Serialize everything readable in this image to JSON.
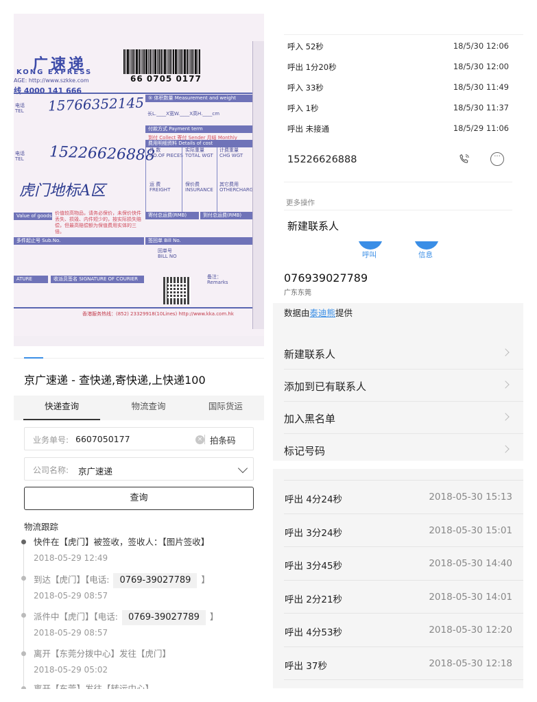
{
  "waybill": {
    "brand_cn": "广速递",
    "brand_en": "KONG EXPRESS",
    "website": "AGE: http://www.szkke.com",
    "hotline": "线 4000 141 666",
    "tracking_number": "66 0705 0177",
    "sender_phone": "15766352145",
    "receiver_phone": "15226626888",
    "receiver_address": "虎门地标A区",
    "label_tel": "电话\nTEL",
    "label_tel2": "电话\nTEL",
    "label_sub_no": "多件起止号 Sub.No.",
    "label_volume": "⑤ 体积数量 Measurement and weight",
    "label_payment": "付款方式 Payment term",
    "label_pay_options": "到付 Collect   寄付 Sender   月结 Monthly",
    "label_fee": "费用明细资料 Details of cost",
    "label_pieces": "件 数\nNO.OF PIECES",
    "label_total_wgt": "实际重量\nTOTAL WGT",
    "label_chg_wgt": "计费重量\nCHG WGT",
    "label_freight": "运 费\nFREIGHT",
    "label_insurance": "保价费\nINSURANCE",
    "label_other": "其它费用\nOTHERCHARGES",
    "label_prepaid": "寄付总运费(RMB)",
    "label_collect": "到付总运费(RMB)",
    "label_bill": "签回单 Bill No.",
    "label_bill_opt": "回单号\nBILL NO",
    "label_signature": "ATURE",
    "label_courier_sign": "收派员签名 SIGNATURE OF COURIER",
    "label_remarks": "备注：\nRemarks",
    "label_value": "Value of goods",
    "label_hk_hotline": "香港服务热线：(852) 23329918(10Lines)  http://www.kka.com.hk",
    "label_notice": "价值较高物品，请务必保价，未保价快件丢失、损毁、内件短少的，按实际损失赔偿，但最高赔偿额为保值费用实体的三倍。"
  },
  "query": {
    "title": "京广速递 - 查快递,寄快递,上快递100",
    "tabs": [
      "快递查询",
      "物流查询",
      "国际货运"
    ],
    "tracking_label": "业务单号:",
    "tracking_value": "6607050177",
    "scan_label": "拍条码",
    "company_label": "公司名称:",
    "company_value": "京广速递",
    "query_button": "查询",
    "tracking_title": "物流跟踪",
    "events": [
      {
        "text": "快件在【虎门】被签收，签收人：【图片签收】",
        "time": "2018-05-29 12:49"
      },
      {
        "prefix": "到达【虎门】【电话:",
        "phone": "0769-39027789",
        "suffix": "】",
        "time": "2018-05-29 08:57"
      },
      {
        "prefix": "派件中【虎门】【电话:",
        "phone": "0769-39027789",
        "suffix": "】",
        "time": "2018-05-29 08:57"
      },
      {
        "text": "离开【东莞分拨中心】发往【虎门】",
        "time": "2018-05-29 05:02"
      },
      {
        "text": "离开【东莞】发往【转运中心】",
        "time": ""
      }
    ]
  },
  "call_top": {
    "rows": [
      {
        "label": "呼入 52秒",
        "time": "18/5/30 12:06"
      },
      {
        "label": "呼出 1分20秒",
        "time": "18/5/30 12:00"
      },
      {
        "label": "呼入 33秒",
        "time": "18/5/30 11:49"
      },
      {
        "label": "呼入 1秒",
        "time": "18/5/30 11:37"
      },
      {
        "label": "呼出 未接通",
        "time": "18/5/29 11:06"
      }
    ],
    "number": "15226626888",
    "more_label": "更多操作",
    "new_contact": "新建联系人"
  },
  "contact": {
    "call_label": "呼叫",
    "msg_label": "信息",
    "number": "076939027789",
    "region": "广东东莞",
    "source_prefix": "数据由",
    "source_link": "泰迪熊",
    "source_suffix": "提供",
    "menu": [
      "新建联系人",
      "添加到已有联系人",
      "加入黑名单",
      "标记号码"
    ]
  },
  "call_bottom": {
    "rows": [
      {
        "label": "呼出 4分24秒",
        "time": "2018-05-30 15:13"
      },
      {
        "label": "呼出 3分24秒",
        "time": "2018-05-30 15:01"
      },
      {
        "label": "呼出 3分45秒",
        "time": "2018-05-30 14:40"
      },
      {
        "label": "呼出 2分21秒",
        "time": "2018-05-30 14:01"
      },
      {
        "label": "呼出 4分53秒",
        "time": "2018-05-30 12:20"
      },
      {
        "label": "呼出 37秒",
        "time": "2018-05-30 12:18"
      }
    ]
  }
}
